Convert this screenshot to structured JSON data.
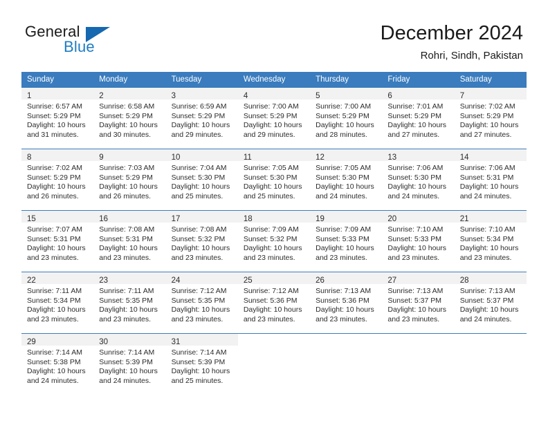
{
  "brand": {
    "name_part1": "General",
    "name_part2": "Blue",
    "triangle_icon": "triangle-icon",
    "accent_color": "#1d7cc4",
    "triangle_color": "#1668b0"
  },
  "header": {
    "month_title": "December 2024",
    "location": "Rohri, Sindh, Pakistan"
  },
  "calendar": {
    "header_bg_color": "#3a7cbe",
    "daynum_band_color": "#f2f2f2",
    "weekday_headers": [
      "Sunday",
      "Monday",
      "Tuesday",
      "Wednesday",
      "Thursday",
      "Friday",
      "Saturday"
    ],
    "weeks": [
      [
        {
          "day": "1",
          "sunrise": "Sunrise: 6:57 AM",
          "sunset": "Sunset: 5:29 PM",
          "daylight_line1": "Daylight: 10 hours",
          "daylight_line2": "and 31 minutes."
        },
        {
          "day": "2",
          "sunrise": "Sunrise: 6:58 AM",
          "sunset": "Sunset: 5:29 PM",
          "daylight_line1": "Daylight: 10 hours",
          "daylight_line2": "and 30 minutes."
        },
        {
          "day": "3",
          "sunrise": "Sunrise: 6:59 AM",
          "sunset": "Sunset: 5:29 PM",
          "daylight_line1": "Daylight: 10 hours",
          "daylight_line2": "and 29 minutes."
        },
        {
          "day": "4",
          "sunrise": "Sunrise: 7:00 AM",
          "sunset": "Sunset: 5:29 PM",
          "daylight_line1": "Daylight: 10 hours",
          "daylight_line2": "and 29 minutes."
        },
        {
          "day": "5",
          "sunrise": "Sunrise: 7:00 AM",
          "sunset": "Sunset: 5:29 PM",
          "daylight_line1": "Daylight: 10 hours",
          "daylight_line2": "and 28 minutes."
        },
        {
          "day": "6",
          "sunrise": "Sunrise: 7:01 AM",
          "sunset": "Sunset: 5:29 PM",
          "daylight_line1": "Daylight: 10 hours",
          "daylight_line2": "and 27 minutes."
        },
        {
          "day": "7",
          "sunrise": "Sunrise: 7:02 AM",
          "sunset": "Sunset: 5:29 PM",
          "daylight_line1": "Daylight: 10 hours",
          "daylight_line2": "and 27 minutes."
        }
      ],
      [
        {
          "day": "8",
          "sunrise": "Sunrise: 7:02 AM",
          "sunset": "Sunset: 5:29 PM",
          "daylight_line1": "Daylight: 10 hours",
          "daylight_line2": "and 26 minutes."
        },
        {
          "day": "9",
          "sunrise": "Sunrise: 7:03 AM",
          "sunset": "Sunset: 5:29 PM",
          "daylight_line1": "Daylight: 10 hours",
          "daylight_line2": "and 26 minutes."
        },
        {
          "day": "10",
          "sunrise": "Sunrise: 7:04 AM",
          "sunset": "Sunset: 5:30 PM",
          "daylight_line1": "Daylight: 10 hours",
          "daylight_line2": "and 25 minutes."
        },
        {
          "day": "11",
          "sunrise": "Sunrise: 7:05 AM",
          "sunset": "Sunset: 5:30 PM",
          "daylight_line1": "Daylight: 10 hours",
          "daylight_line2": "and 25 minutes."
        },
        {
          "day": "12",
          "sunrise": "Sunrise: 7:05 AM",
          "sunset": "Sunset: 5:30 PM",
          "daylight_line1": "Daylight: 10 hours",
          "daylight_line2": "and 24 minutes."
        },
        {
          "day": "13",
          "sunrise": "Sunrise: 7:06 AM",
          "sunset": "Sunset: 5:30 PM",
          "daylight_line1": "Daylight: 10 hours",
          "daylight_line2": "and 24 minutes."
        },
        {
          "day": "14",
          "sunrise": "Sunrise: 7:06 AM",
          "sunset": "Sunset: 5:31 PM",
          "daylight_line1": "Daylight: 10 hours",
          "daylight_line2": "and 24 minutes."
        }
      ],
      [
        {
          "day": "15",
          "sunrise": "Sunrise: 7:07 AM",
          "sunset": "Sunset: 5:31 PM",
          "daylight_line1": "Daylight: 10 hours",
          "daylight_line2": "and 23 minutes."
        },
        {
          "day": "16",
          "sunrise": "Sunrise: 7:08 AM",
          "sunset": "Sunset: 5:31 PM",
          "daylight_line1": "Daylight: 10 hours",
          "daylight_line2": "and 23 minutes."
        },
        {
          "day": "17",
          "sunrise": "Sunrise: 7:08 AM",
          "sunset": "Sunset: 5:32 PM",
          "daylight_line1": "Daylight: 10 hours",
          "daylight_line2": "and 23 minutes."
        },
        {
          "day": "18",
          "sunrise": "Sunrise: 7:09 AM",
          "sunset": "Sunset: 5:32 PM",
          "daylight_line1": "Daylight: 10 hours",
          "daylight_line2": "and 23 minutes."
        },
        {
          "day": "19",
          "sunrise": "Sunrise: 7:09 AM",
          "sunset": "Sunset: 5:33 PM",
          "daylight_line1": "Daylight: 10 hours",
          "daylight_line2": "and 23 minutes."
        },
        {
          "day": "20",
          "sunrise": "Sunrise: 7:10 AM",
          "sunset": "Sunset: 5:33 PM",
          "daylight_line1": "Daylight: 10 hours",
          "daylight_line2": "and 23 minutes."
        },
        {
          "day": "21",
          "sunrise": "Sunrise: 7:10 AM",
          "sunset": "Sunset: 5:34 PM",
          "daylight_line1": "Daylight: 10 hours",
          "daylight_line2": "and 23 minutes."
        }
      ],
      [
        {
          "day": "22",
          "sunrise": "Sunrise: 7:11 AM",
          "sunset": "Sunset: 5:34 PM",
          "daylight_line1": "Daylight: 10 hours",
          "daylight_line2": "and 23 minutes."
        },
        {
          "day": "23",
          "sunrise": "Sunrise: 7:11 AM",
          "sunset": "Sunset: 5:35 PM",
          "daylight_line1": "Daylight: 10 hours",
          "daylight_line2": "and 23 minutes."
        },
        {
          "day": "24",
          "sunrise": "Sunrise: 7:12 AM",
          "sunset": "Sunset: 5:35 PM",
          "daylight_line1": "Daylight: 10 hours",
          "daylight_line2": "and 23 minutes."
        },
        {
          "day": "25",
          "sunrise": "Sunrise: 7:12 AM",
          "sunset": "Sunset: 5:36 PM",
          "daylight_line1": "Daylight: 10 hours",
          "daylight_line2": "and 23 minutes."
        },
        {
          "day": "26",
          "sunrise": "Sunrise: 7:13 AM",
          "sunset": "Sunset: 5:36 PM",
          "daylight_line1": "Daylight: 10 hours",
          "daylight_line2": "and 23 minutes."
        },
        {
          "day": "27",
          "sunrise": "Sunrise: 7:13 AM",
          "sunset": "Sunset: 5:37 PM",
          "daylight_line1": "Daylight: 10 hours",
          "daylight_line2": "and 23 minutes."
        },
        {
          "day": "28",
          "sunrise": "Sunrise: 7:13 AM",
          "sunset": "Sunset: 5:37 PM",
          "daylight_line1": "Daylight: 10 hours",
          "daylight_line2": "and 24 minutes."
        }
      ],
      [
        {
          "day": "29",
          "sunrise": "Sunrise: 7:14 AM",
          "sunset": "Sunset: 5:38 PM",
          "daylight_line1": "Daylight: 10 hours",
          "daylight_line2": "and 24 minutes."
        },
        {
          "day": "30",
          "sunrise": "Sunrise: 7:14 AM",
          "sunset": "Sunset: 5:39 PM",
          "daylight_line1": "Daylight: 10 hours",
          "daylight_line2": "and 24 minutes."
        },
        {
          "day": "31",
          "sunrise": "Sunrise: 7:14 AM",
          "sunset": "Sunset: 5:39 PM",
          "daylight_line1": "Daylight: 10 hours",
          "daylight_line2": "and 25 minutes."
        },
        {
          "day": "",
          "sunrise": "",
          "sunset": "",
          "daylight_line1": "",
          "daylight_line2": ""
        },
        {
          "day": "",
          "sunrise": "",
          "sunset": "",
          "daylight_line1": "",
          "daylight_line2": ""
        },
        {
          "day": "",
          "sunrise": "",
          "sunset": "",
          "daylight_line1": "",
          "daylight_line2": ""
        },
        {
          "day": "",
          "sunrise": "",
          "sunset": "",
          "daylight_line1": "",
          "daylight_line2": ""
        }
      ]
    ]
  }
}
